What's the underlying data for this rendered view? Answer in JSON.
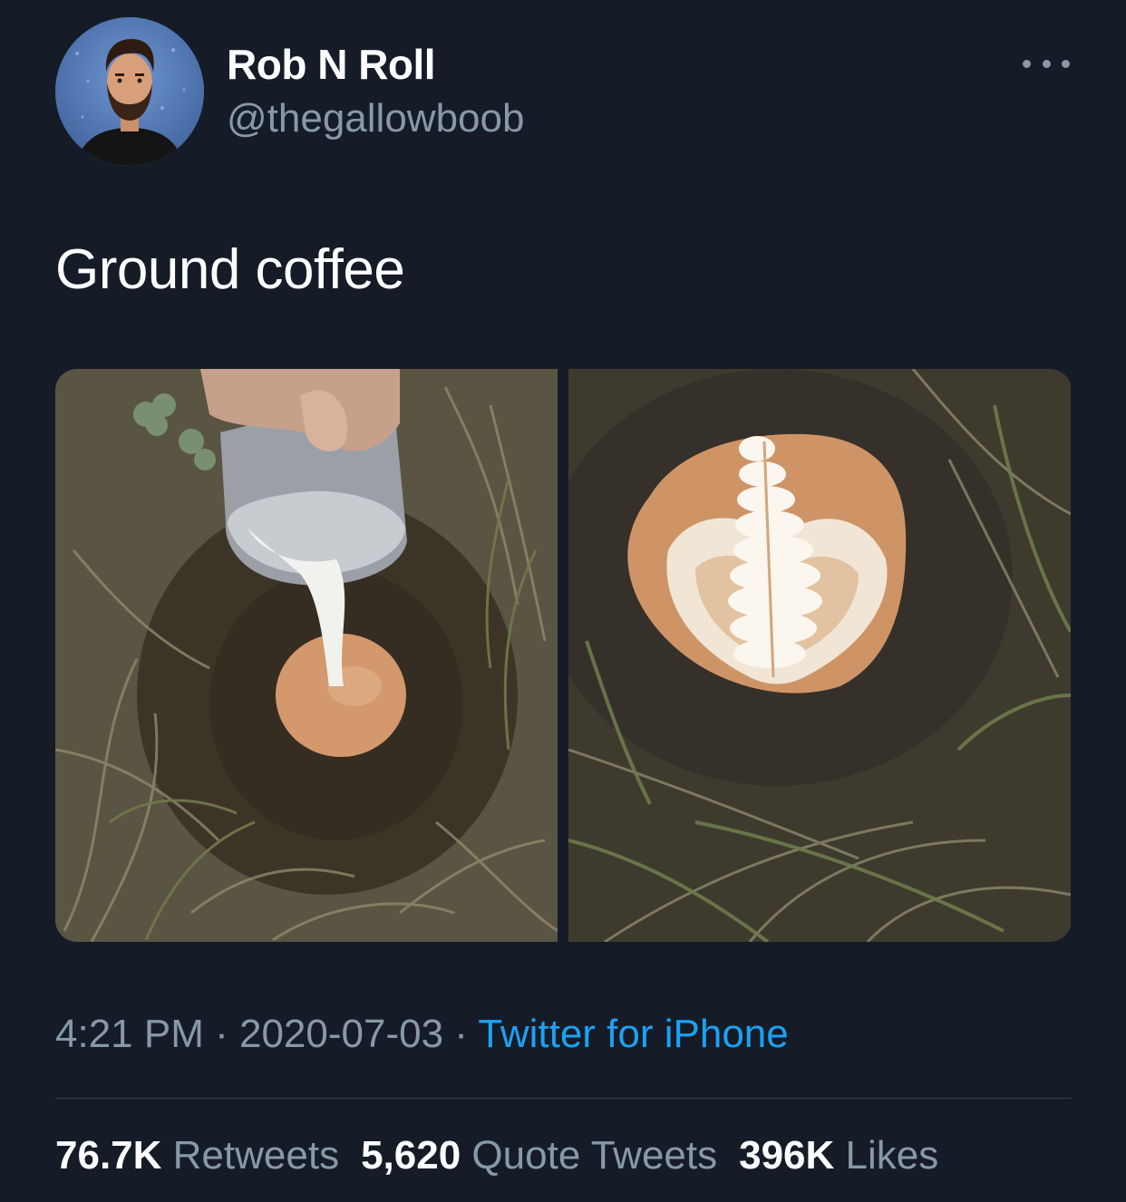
{
  "author": {
    "display_name": "Rob N Roll",
    "handle": "@thegallowboob",
    "avatar_icon": "user-avatar"
  },
  "more_icon": "more-dots-icon",
  "tweet": {
    "text": "Ground coffee",
    "media": [
      {
        "name": "milk-pouring-into-ground-photo"
      },
      {
        "name": "latte-art-in-ground-photo"
      }
    ]
  },
  "meta": {
    "time": "4:21 PM",
    "separator": " · ",
    "date": "2020-07-03",
    "source": "Twitter for iPhone"
  },
  "stats": {
    "retweets_count": "76.7K",
    "retweets_label": "Retweets",
    "quotes_count": "5,620",
    "quotes_label": "Quote Tweets",
    "likes_count": "396K",
    "likes_label": "Likes"
  },
  "colors": {
    "background": "#151c28",
    "secondary_text": "#8899a6",
    "link": "#1da1f2"
  }
}
